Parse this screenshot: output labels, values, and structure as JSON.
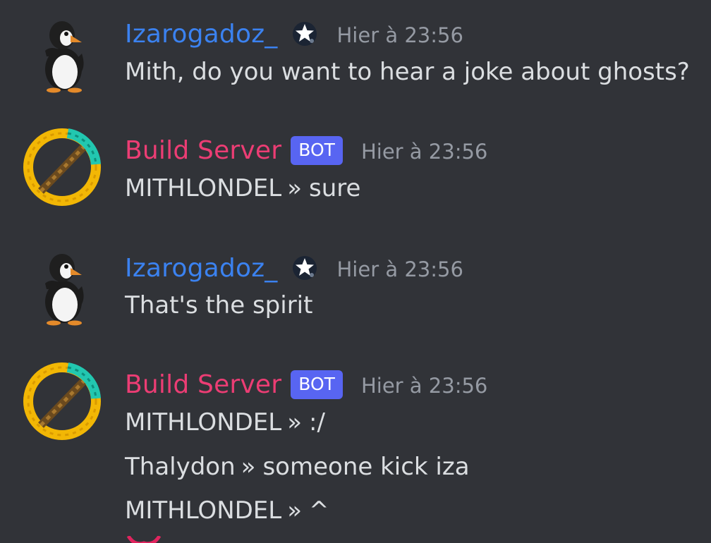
{
  "messages": [
    {
      "author": "Izarogadoz_",
      "timestamp": "Hier à 23:56",
      "role_icon": "star-badge-icon",
      "lines": [
        {
          "text": "Mith, do you want to hear a joke about ghosts?"
        }
      ]
    },
    {
      "author": "Build Server",
      "bot_tag": "BOT",
      "timestamp": "Hier à 23:56",
      "lines": [
        {
          "speaker": "MITHLONDEL",
          "sep": "»",
          "text": "sure"
        }
      ]
    },
    {
      "author": "Izarogadoz_",
      "timestamp": "Hier à 23:56",
      "role_icon": "star-badge-icon",
      "lines": [
        {
          "text": "That's the spirit"
        }
      ]
    },
    {
      "author": "Build Server",
      "bot_tag": "BOT",
      "timestamp": "Hier à 23:56",
      "lines": [
        {
          "speaker": "MITHLONDEL",
          "sep": "»",
          "text": ":/"
        },
        {
          "speaker": "Thalydon",
          "sep": "»",
          "text": "someone kick iza"
        },
        {
          "speaker": "MITHLONDEL",
          "sep": "»",
          "text": "^"
        }
      ]
    }
  ],
  "colors": {
    "background": "#313338",
    "user_name": "#3b82f0",
    "bot_name": "#ec3d74",
    "bot_tag": "#5865f2",
    "timestamp": "#959aa3",
    "text": "#dbdee1"
  }
}
